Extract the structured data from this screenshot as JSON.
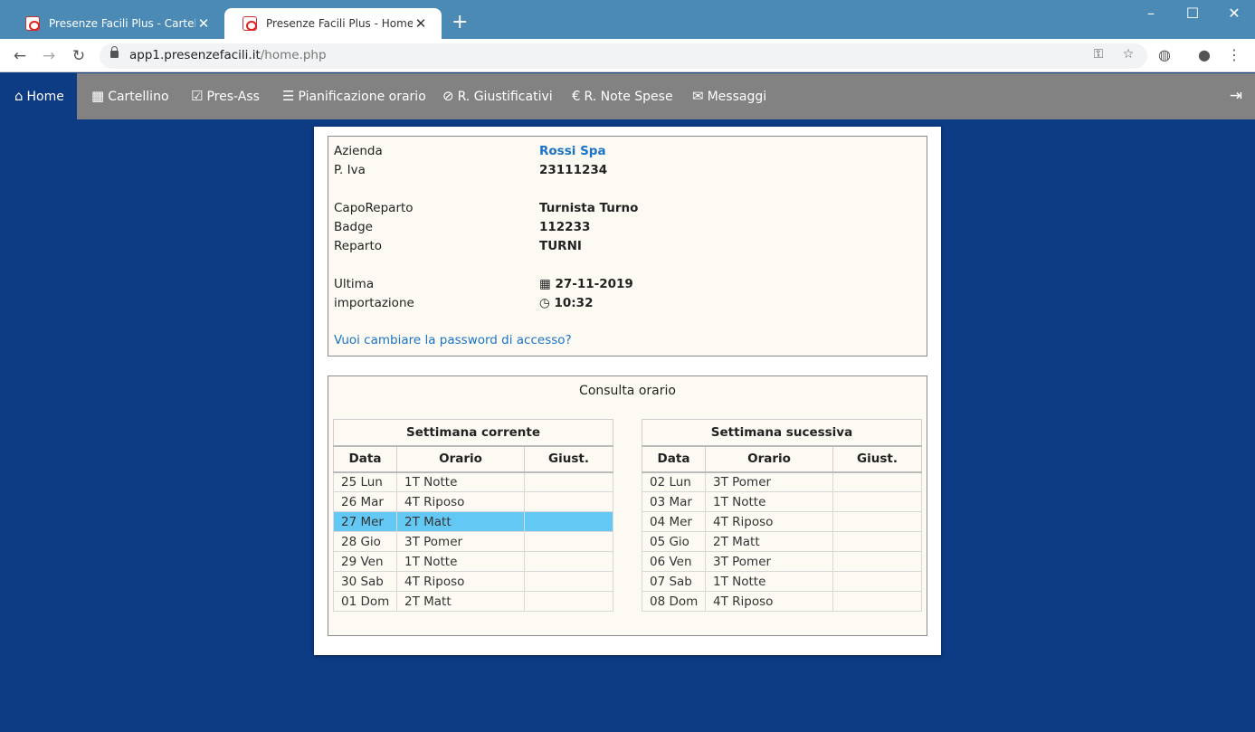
{
  "browser": {
    "tabs": [
      {
        "title": "Presenze Facili Plus - Cartellino",
        "active": false
      },
      {
        "title": "Presenze Facili Plus - Home",
        "active": true
      }
    ],
    "url_host": "app1.presenzefacili.it",
    "url_path": "/home.php"
  },
  "nav": {
    "items": [
      {
        "label": "Home",
        "icon": "home-icon"
      },
      {
        "label": "Cartellino",
        "icon": "calendar-icon"
      },
      {
        "label": "Pres-Ass",
        "icon": "check-square-icon"
      },
      {
        "label": "Pianificazione orario",
        "icon": "list-icon"
      },
      {
        "label": "R. Giustificativi",
        "icon": "paperclip-icon"
      },
      {
        "label": "R. Note Spese",
        "icon": "euro-icon"
      },
      {
        "label": "Messaggi",
        "icon": "envelope-icon"
      }
    ],
    "active_color": "#0d3b84",
    "bar_color": "#828282"
  },
  "info": {
    "azienda_label": "Azienda",
    "azienda_value": "Rossi Spa",
    "piva_label": "P. Iva",
    "piva_value": "23111234",
    "caporeparto_label": "CapoReparto",
    "caporeparto_value": "Turnista Turno",
    "badge_label": "Badge",
    "badge_value": "112233",
    "reparto_label": "Reparto",
    "reparto_value": "TURNI",
    "ultima_label_1": "Ultima",
    "ultima_label_2": "importazione",
    "date_value": "27-11-2019",
    "time_value": "10:32",
    "password_link": "Vuoi cambiare la password di accesso?"
  },
  "orario": {
    "title": "Consulta orario",
    "columns": [
      "Data",
      "Orario",
      "Giust."
    ],
    "current_week": {
      "caption": "Settimana corrente",
      "rows": [
        {
          "data": "25 Lun",
          "orario": "1T Notte",
          "giust": ""
        },
        {
          "data": "26 Mar",
          "orario": "4T Riposo",
          "giust": ""
        },
        {
          "data": "27 Mer",
          "orario": "2T Matt",
          "giust": "",
          "highlight": true
        },
        {
          "data": "28 Gio",
          "orario": "3T Pomer",
          "giust": ""
        },
        {
          "data": "29 Ven",
          "orario": "1T Notte",
          "giust": ""
        },
        {
          "data": "30 Sab",
          "orario": "4T Riposo",
          "giust": ""
        },
        {
          "data": "01 Dom",
          "orario": "2T Matt",
          "giust": ""
        }
      ]
    },
    "next_week": {
      "caption": "Settimana sucessiva",
      "rows": [
        {
          "data": "02 Lun",
          "orario": "3T Pomer",
          "giust": ""
        },
        {
          "data": "03 Mar",
          "orario": "1T Notte",
          "giust": ""
        },
        {
          "data": "04 Mer",
          "orario": "4T Riposo",
          "giust": ""
        },
        {
          "data": "05 Gio",
          "orario": "2T Matt",
          "giust": ""
        },
        {
          "data": "06 Ven",
          "orario": "3T Pomer",
          "giust": ""
        },
        {
          "data": "07 Sab",
          "orario": "1T Notte",
          "giust": ""
        },
        {
          "data": "08 Dom",
          "orario": "4T Riposo",
          "giust": ""
        }
      ]
    },
    "highlight_color": "#64c8f5"
  }
}
